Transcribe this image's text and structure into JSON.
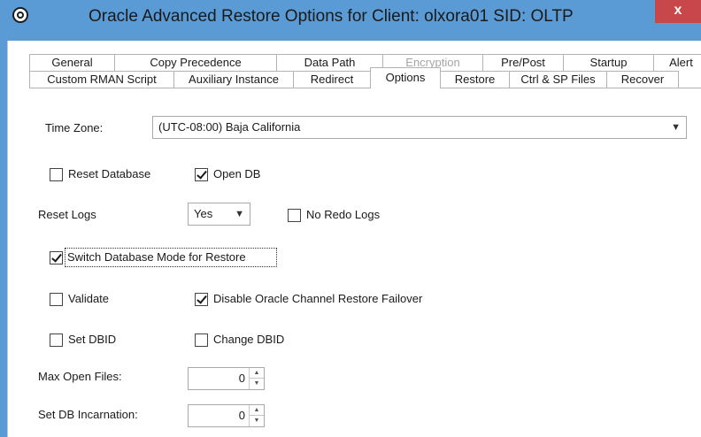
{
  "window": {
    "title": "Oracle Advanced Restore Options for Client: olxora01  SID: OLTP",
    "close_label": "x"
  },
  "tabs_row1": [
    {
      "label": "General",
      "disabled": false
    },
    {
      "label": "Copy Precedence",
      "disabled": false
    },
    {
      "label": "Data Path",
      "disabled": false
    },
    {
      "label": "Encryption",
      "disabled": true
    },
    {
      "label": "Pre/Post",
      "disabled": false
    },
    {
      "label": "Startup",
      "disabled": false
    },
    {
      "label": "Alert",
      "disabled": false
    }
  ],
  "tabs_row2": [
    {
      "label": "Custom RMAN Script",
      "active": false
    },
    {
      "label": "Auxiliary Instance",
      "active": false
    },
    {
      "label": "Redirect",
      "active": false
    },
    {
      "label": "Options",
      "active": true
    },
    {
      "label": "Restore",
      "active": false
    },
    {
      "label": "Ctrl & SP Files",
      "active": false
    },
    {
      "label": "Recover",
      "active": false
    }
  ],
  "options": {
    "time_zone_label": "Time Zone:",
    "time_zone_value": "(UTC-08:00) Baja California",
    "reset_database": {
      "label": "Reset Database",
      "checked": false
    },
    "open_db": {
      "label": "Open DB",
      "checked": true
    },
    "reset_logs_label": "Reset Logs",
    "reset_logs_value": "Yes",
    "no_redo_logs": {
      "label": "No Redo Logs",
      "checked": false
    },
    "switch_db_mode": {
      "label": "Switch Database Mode for Restore",
      "checked": true
    },
    "validate": {
      "label": "Validate",
      "checked": false
    },
    "disable_failover": {
      "label": "Disable Oracle Channel Restore Failover",
      "checked": true
    },
    "set_dbid": {
      "label": "Set DBID",
      "checked": false
    },
    "change_dbid": {
      "label": "Change DBID",
      "checked": false
    },
    "max_open_files_label": "Max Open Files:",
    "max_open_files_value": "0",
    "set_db_incarnation_label": "Set DB Incarnation:",
    "set_db_incarnation_value": "0"
  },
  "colors": {
    "titlebar": "#5b9bd5",
    "close_button": "#c7474b"
  }
}
